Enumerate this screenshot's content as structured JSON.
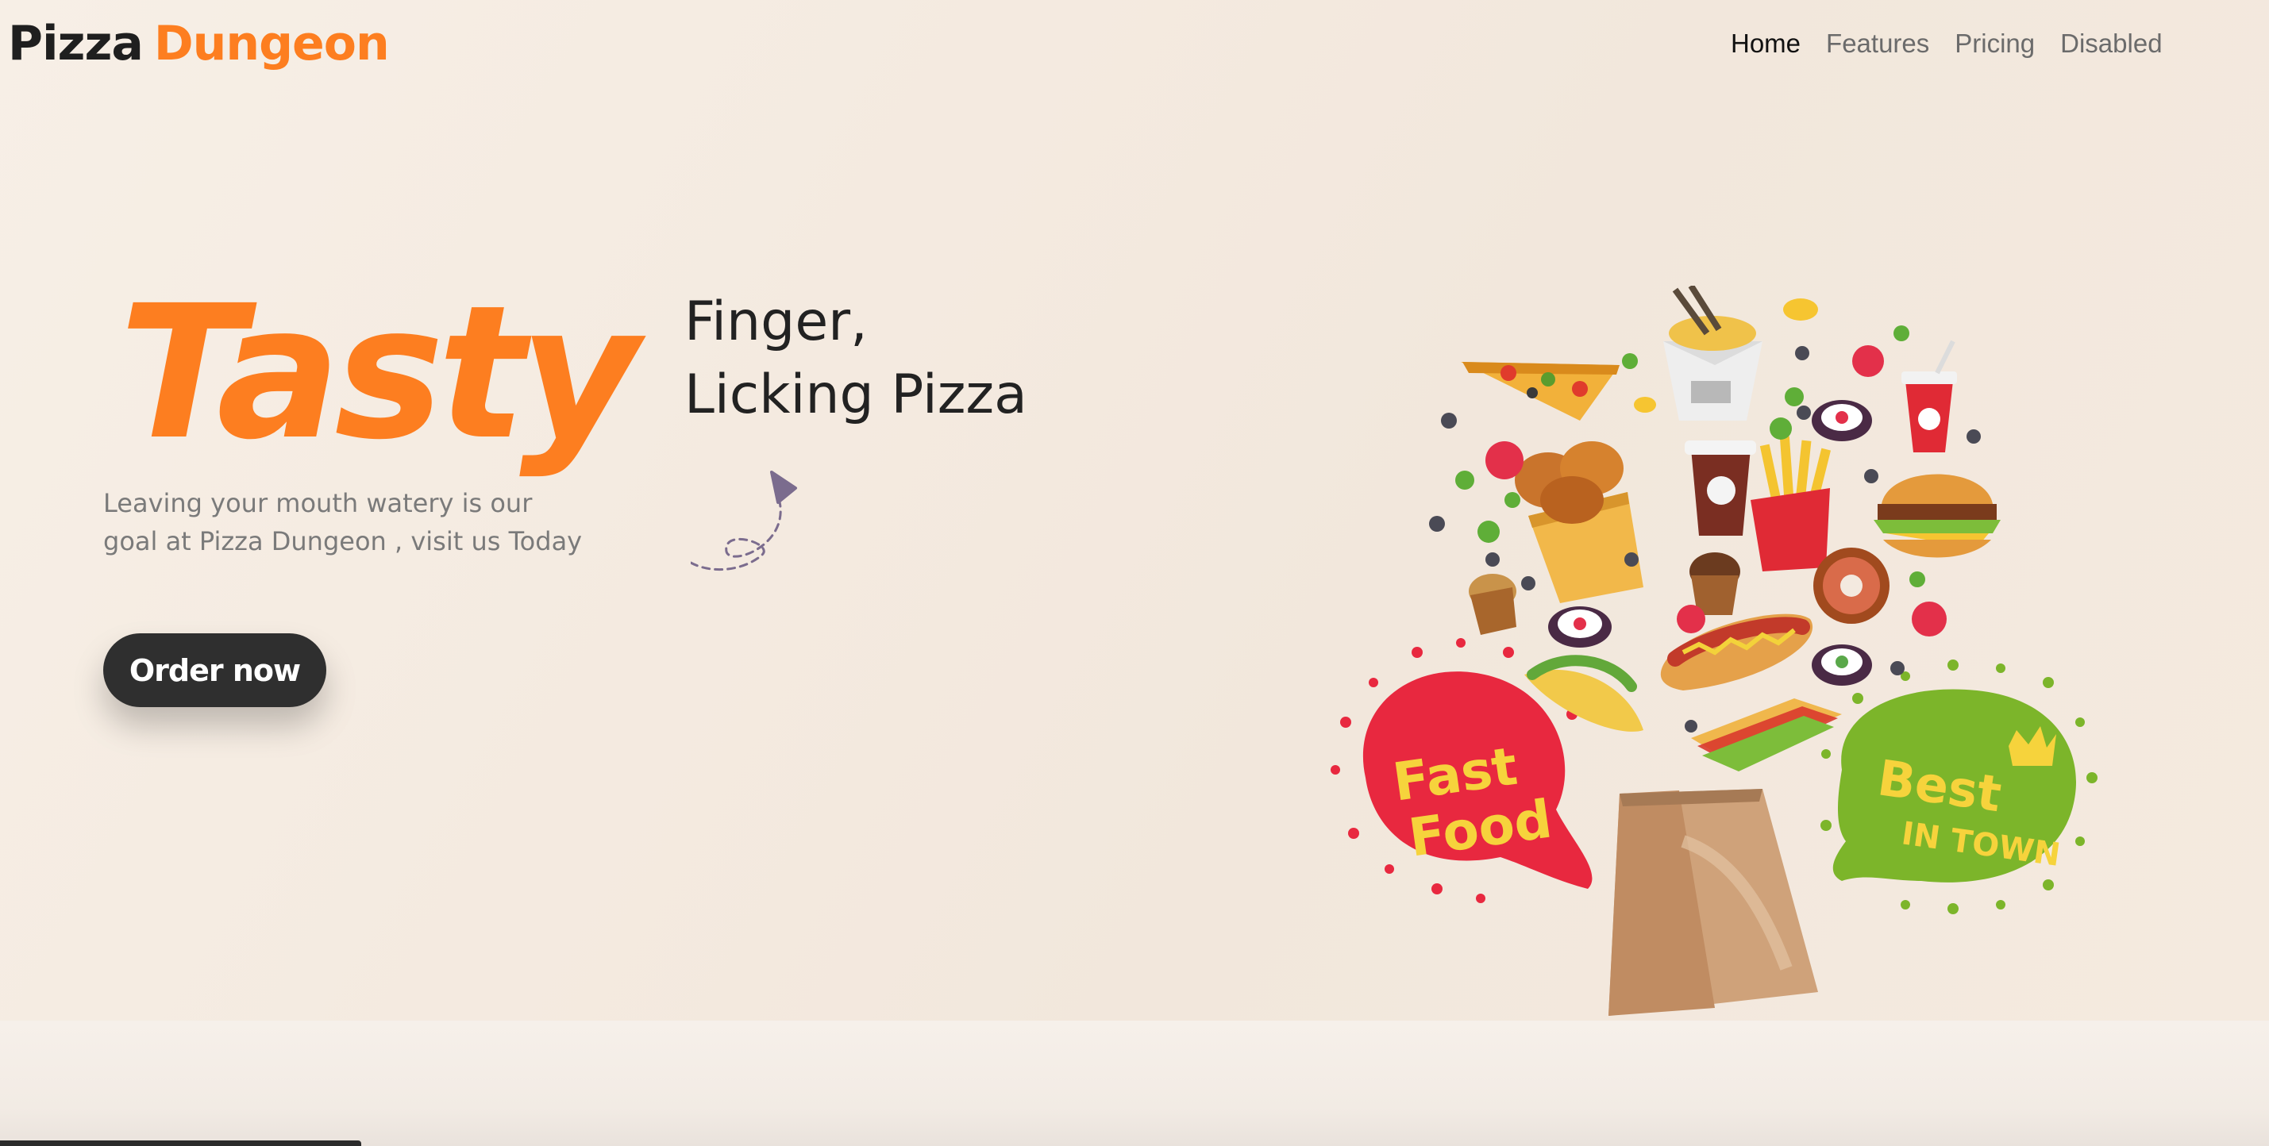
{
  "brand": {
    "part1": "Pizza",
    "part2": "Dungeon"
  },
  "nav": {
    "items": [
      {
        "label": "Home"
      },
      {
        "label": "Features"
      },
      {
        "label": "Pricing"
      },
      {
        "label": "Disabled"
      }
    ]
  },
  "hero": {
    "headline": "Tasty",
    "tagline_line1": "Finger,",
    "tagline_line2": "Licking Pizza",
    "subtext_line1": "Leaving your mouth watery is our",
    "subtext_line2": "goal at Pizza Dungeon , visit us Today",
    "cta_label": "Order now"
  },
  "illustration": {
    "badge_left_line1": "Fast",
    "badge_left_line2": "Food",
    "badge_right_line1": "Best",
    "badge_right_line2": "IN TOWN"
  },
  "colors": {
    "accent": "#fd7e20",
    "dark": "#2f2f2f",
    "badge_red": "#e8283f",
    "badge_green": "#7cb52a",
    "badge_text": "#f6d33c"
  }
}
